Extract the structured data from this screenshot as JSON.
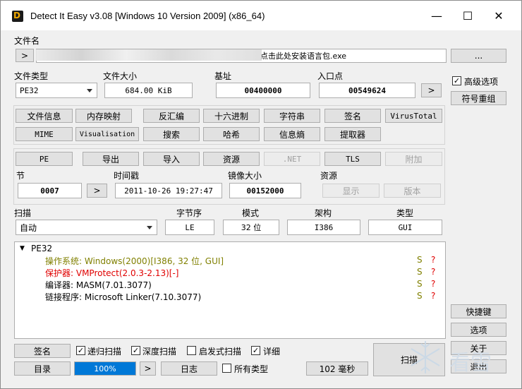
{
  "titlebar": {
    "title": "Detect It Easy v3.08 [Windows 10 Version 2009] (x86_64)",
    "icon_letter": "D",
    "min": "—",
    "max": "☐",
    "close": "✕"
  },
  "file": {
    "label": "文件名",
    "arrow_btn": ">",
    "path_visible": "点击此处安装语言包.exe",
    "browse_btn": "..."
  },
  "info": {
    "filetype_label": "文件类型",
    "filetype_value": "PE32",
    "filesize_label": "文件大小",
    "filesize_value": "684.00 KiB",
    "base_label": "基址",
    "base_value": "00400000",
    "entry_label": "入口点",
    "entry_value": "00549624",
    "entry_btn": ">"
  },
  "advanced": {
    "checkbox_label": "高级选项",
    "checked": true,
    "symbol_btn": "符号重组"
  },
  "tools_row1": [
    "文件信息",
    "内存映射",
    "反汇编",
    "十六进制",
    "字符串",
    "签名",
    "VirusTotal"
  ],
  "tools_row2": [
    "MIME",
    "Visualisation",
    "搜索",
    "哈希",
    "信息熵",
    "提取器"
  ],
  "pe_row": {
    "pe": "PE",
    "export": "导出",
    "import": "导入",
    "resource": "资源",
    "net": ".NET",
    "tls": "TLS",
    "overlay": "附加"
  },
  "sections": {
    "section_label": "节",
    "section_value": "0007",
    "section_btn": ">",
    "timestamp_label": "时间戳",
    "timestamp_value": "2011-10-26 19:27:47",
    "imagesize_label": "镜像大小",
    "imagesize_value": "00152000",
    "resource_label": "资源",
    "show_btn": "显示",
    "version_btn": "版本"
  },
  "scan": {
    "scan_label": "扫描",
    "scan_value": "自动",
    "endian_label": "字节序",
    "endian_value": "LE",
    "mode_label": "模式",
    "mode_value": "32 位",
    "arch_label": "架构",
    "arch_value": "I386",
    "type_label": "类型",
    "type_value": "GUI"
  },
  "results": {
    "root": "PE32",
    "items": [
      {
        "text": "操作系统: Windows(2000)[I386, 32 位, GUI]",
        "color": "#808000",
        "s": "S",
        "q": "?"
      },
      {
        "text": "保护器: VMProtect(2.0.3-2.13)[-]",
        "color": "#e00000",
        "s": "S",
        "q": "?"
      },
      {
        "text": "编译器: MASM(7.01.3077)",
        "color": "#000000",
        "s": "S",
        "q": "?"
      },
      {
        "text": "链接程序: Microsoft Linker(7.10.3077)",
        "color": "#000000",
        "s": "S",
        "q": "?"
      }
    ],
    "s_color": "#808000",
    "q_color": "#e00000"
  },
  "bottom": {
    "sign_btn": "签名",
    "recursive": "递归扫描",
    "deep": "深度扫描",
    "heuristic": "启发式扫描",
    "verbose": "详细",
    "dir_btn": "目录",
    "progress": "100%",
    "progress_fraction": 1.0,
    "next_btn": ">",
    "log_btn": "日志",
    "alltypes": "所有类型",
    "time": "102 毫秒",
    "scan_btn": "扫描"
  },
  "side": {
    "shortcut_btn": "快捷键",
    "options_btn": "选项",
    "about_btn": "关于",
    "exit_btn": "退出"
  },
  "watermark": {
    "text": "看雪"
  }
}
